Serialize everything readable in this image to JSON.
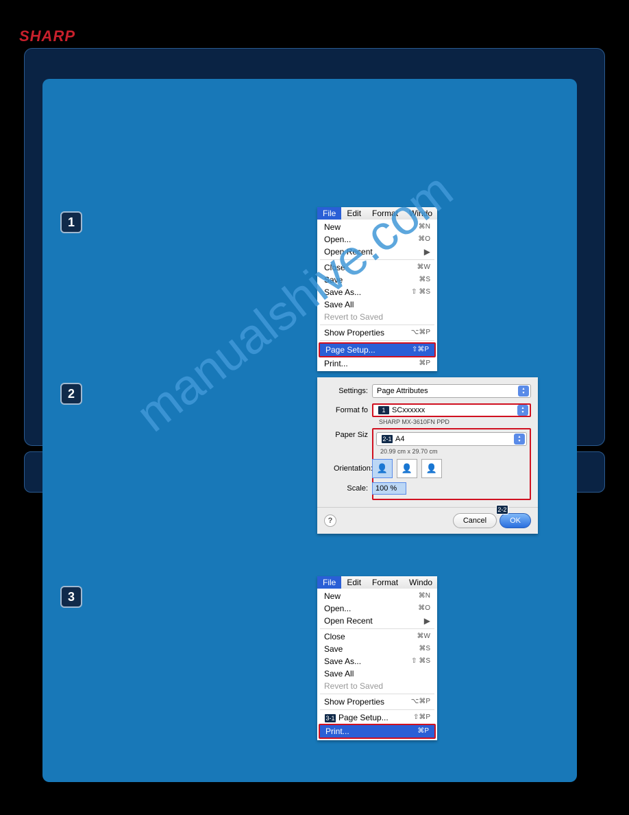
{
  "brand": "SHARP",
  "watermark": "manualshive.com",
  "steps": {
    "s1": "1",
    "s2": "2",
    "s3": "3"
  },
  "menubar": {
    "file": "File",
    "edit": "Edit",
    "format": "Format",
    "window": "Windo"
  },
  "menu": {
    "new": "New",
    "new_sc": "⌘N",
    "open": "Open...",
    "open_sc": "⌘O",
    "open_recent": "Open Recent",
    "close": "Close",
    "close_sc": "⌘W",
    "save": "Save",
    "save_sc": "⌘S",
    "save_as": "Save As...",
    "save_as_sc": "⇧ ⌘S",
    "save_all": "Save All",
    "revert": "Revert to Saved",
    "show_props": "Show Properties",
    "show_props_sc": "⌥⌘P",
    "page_setup": "Page Setup...",
    "page_setup_sc": "⇧⌘P",
    "print": "Print...",
    "print_sc": "⌘P"
  },
  "dialog": {
    "settings_label": "Settings:",
    "settings_value": "Page Attributes",
    "format_label": "Format fo",
    "format_value": "SCxxxxxx",
    "ppd": "SHARP MX-3610FN PPD",
    "paper_label": "Paper Siz",
    "paper_value": "A4",
    "paper_dim": "20.99 cm x 29.70 cm",
    "orient_label": "Orientation:",
    "scale_label": "Scale:",
    "scale_value": "100 %",
    "cancel": "Cancel",
    "ok": "OK",
    "help": "?",
    "badge1": "1",
    "badge21": "2-1",
    "badge22": "2-2",
    "badge31": "3-1"
  }
}
